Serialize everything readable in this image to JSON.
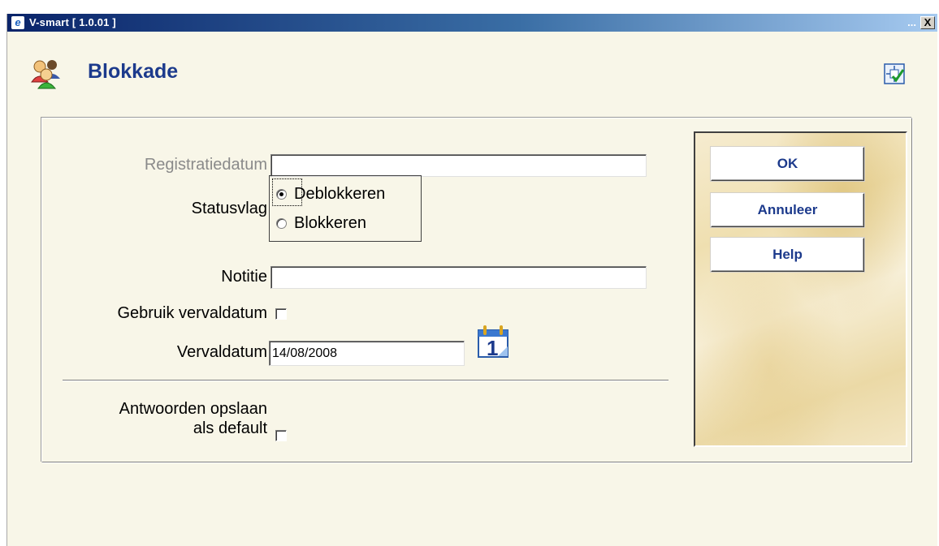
{
  "window": {
    "title": "V-smart [ 1.0.01 ]",
    "minimize_label": "...",
    "close_label": "X"
  },
  "header": {
    "title": "Blokkade"
  },
  "form": {
    "registratiedatum": {
      "label": "Registratiedatum",
      "value": ""
    },
    "statusvlag": {
      "label": "Statusvlag",
      "options": [
        {
          "label": "Deblokkeren",
          "selected": true
        },
        {
          "label": "Blokkeren",
          "selected": false
        }
      ]
    },
    "notitie": {
      "label": "Notitie",
      "value": ""
    },
    "gebruik_vervaldatum": {
      "label": "Gebruik vervaldatum",
      "checked": false
    },
    "vervaldatum": {
      "label": "Vervaldatum",
      "value": "14/08/2008",
      "calendar_day": "1"
    },
    "antwoorden_default": {
      "label_line1": "Antwoorden opslaan",
      "label_line2": "als default",
      "checked": false
    }
  },
  "buttons": {
    "ok": "OK",
    "annuleer": "Annuleer",
    "help": "Help"
  },
  "colors": {
    "title": "#1c3a8c",
    "background": "#f8f6e8",
    "button_text": "#1c3a8c"
  },
  "icons": {
    "header": "users-icon",
    "layout": "layout-check-icon",
    "calendar": "calendar-icon"
  }
}
